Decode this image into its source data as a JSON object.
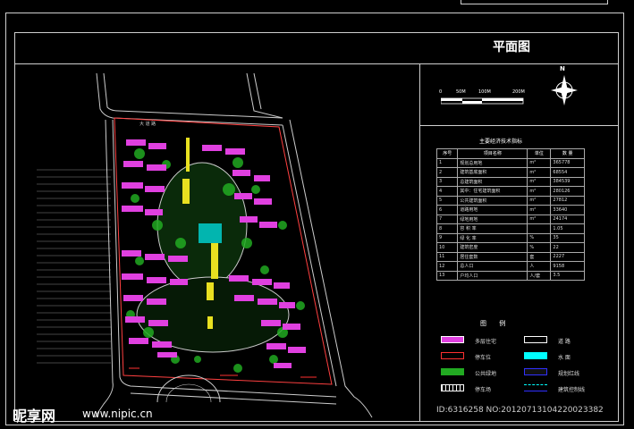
{
  "title": "平面图",
  "north_label": "N",
  "scale": {
    "labels": [
      "0",
      "50M",
      "100M",
      "200M"
    ]
  },
  "table": {
    "title": "主要经济技术指标",
    "headers": [
      "序号",
      "项目名称",
      "单位",
      "数 量"
    ],
    "rows": [
      {
        "no": "1",
        "name": "规划总用地",
        "unit": "m²",
        "val": "365778"
      },
      {
        "no": "2",
        "name": "建筑基底面积",
        "unit": "m²",
        "val": "68554"
      },
      {
        "no": "3",
        "name": "总建筑面积",
        "unit": "m²",
        "val": "384539"
      },
      {
        "no": "4",
        "name": "其中：住宅建筑面积",
        "unit": "m²",
        "val": "280126"
      },
      {
        "no": "5",
        "name": "公共建筑面积",
        "unit": "m²",
        "val": "27812"
      },
      {
        "no": "6",
        "name": "道路用地",
        "unit": "m²",
        "val": "33640"
      },
      {
        "no": "7",
        "name": "绿地用地",
        "unit": "m²",
        "val": "24174"
      },
      {
        "no": "8",
        "name": "容 积 率",
        "unit": "",
        "val": "1.05"
      },
      {
        "no": "9",
        "name": "绿 化 率",
        "unit": "%",
        "val": "35"
      },
      {
        "no": "10",
        "name": "建筑密度",
        "unit": "%",
        "val": "22"
      },
      {
        "no": "11",
        "name": "居住套数",
        "unit": "套",
        "val": "2227"
      },
      {
        "no": "12",
        "name": "总人口",
        "unit": "人",
        "val": "9158"
      },
      {
        "no": "13",
        "name": "户均人口",
        "unit": "人/套",
        "val": "3.5"
      }
    ]
  },
  "legend": {
    "title": "图 例",
    "items": [
      {
        "label": "多层住宅",
        "color": "#e040e0"
      },
      {
        "label": "道  路",
        "color": "#ffffff"
      },
      {
        "label": "停车位",
        "color": "#ff3030"
      },
      {
        "label": "水 面",
        "color": "#00ffff"
      },
      {
        "label": "公共绿地",
        "color": "#22aa22"
      },
      {
        "label": "规划红线",
        "color": "#3030ff"
      },
      {
        "label": "停车场",
        "color": "#ffffff"
      },
      {
        "label": "建筑控制线",
        "color": "#00ffff"
      }
    ]
  },
  "road_label": "大 道 路",
  "watermark": {
    "logo": "昵享网",
    "url": "www.nipic.cn",
    "id": "ID:6316258 NO:20120713104220023382"
  }
}
